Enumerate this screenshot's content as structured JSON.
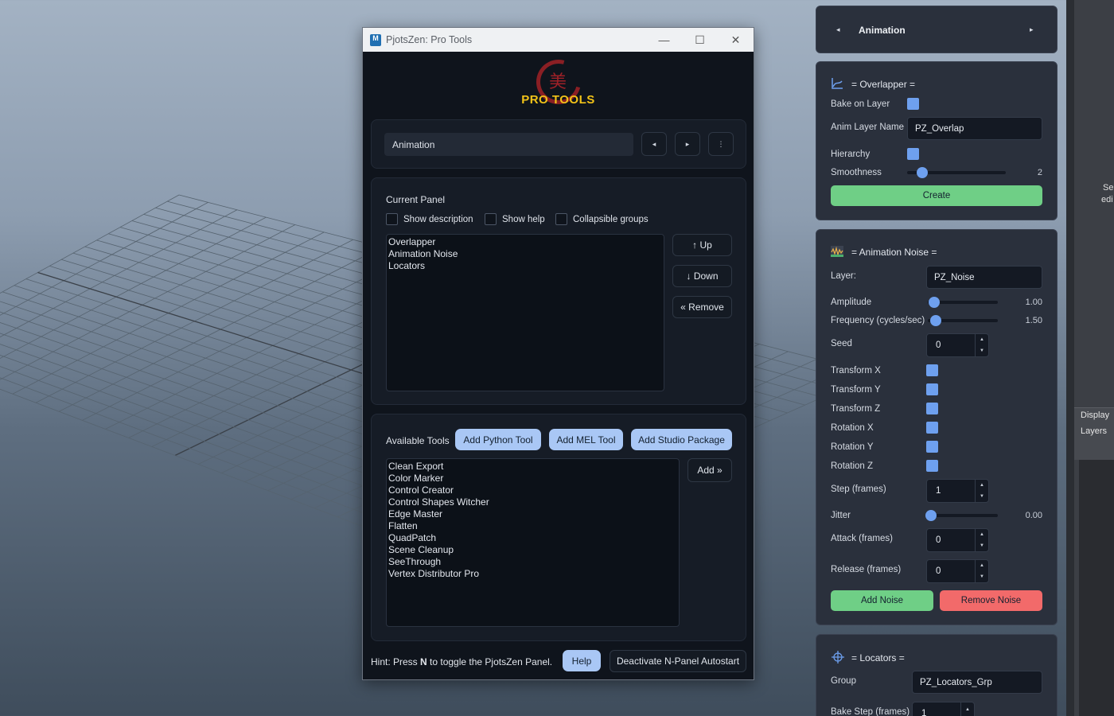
{
  "window": {
    "title": "PjotsZen: Pro Tools",
    "app_icon": "M",
    "minimize": "—",
    "maximize": "☐",
    "close": "✕",
    "brand_kanji": "美",
    "brand_text": "PRO TOOLS",
    "panel_selector": {
      "value": "Animation",
      "prev": "◂",
      "next": "▸",
      "menu": "⋮"
    },
    "current_panel": {
      "heading": "Current Panel",
      "show_description": "Show description",
      "show_help": "Show help",
      "collapsible_groups": "Collapsible groups",
      "items": [
        "Overlapper",
        "Animation Noise",
        "Locators"
      ],
      "up": "↑ Up",
      "down": "↓ Down",
      "remove": "« Remove"
    },
    "available_tools": {
      "heading": "Available Tools",
      "add_python": "Add Python Tool",
      "add_mel": "Add MEL Tool",
      "add_studio": "Add Studio Package",
      "items": [
        "Clean Export",
        "Color Marker",
        "Control Creator",
        "Control Shapes Witcher",
        "Edge Master",
        "Flatten",
        "QuadPatch",
        "Scene Cleanup",
        "SeeThrough",
        "Vertex Distributor Pro"
      ],
      "add": "Add »"
    },
    "footer": {
      "hint_pre": "Hint: Press ",
      "hint_key": "N",
      "hint_post": " to toggle the PjotsZen Panel.",
      "help": "Help",
      "deactivate": "Deactivate N-Panel Autostart"
    }
  },
  "npanel": {
    "header": {
      "title": "Animation",
      "prev": "◂",
      "next": "▸"
    },
    "overlapper": {
      "title": "= Overlapper =",
      "bake_on_layer": "Bake on Layer",
      "anim_layer_name_label": "Anim Layer Name",
      "anim_layer_name": "PZ_Overlap",
      "hierarchy": "Hierarchy",
      "smoothness_label": "Smoothness",
      "smoothness_value": "2",
      "smoothness_fraction": 0.15,
      "create": "Create"
    },
    "noise": {
      "title": "= Animation Noise =",
      "layer_label": "Layer:",
      "layer": "PZ_Noise",
      "amplitude_label": "Amplitude",
      "amplitude": "1.00",
      "frequency_label": "Frequency (cycles/sec)",
      "frequency": "1.50",
      "seed_label": "Seed",
      "seed": "0",
      "transform_x": "Transform X",
      "transform_y": "Transform Y",
      "transform_z": "Transform Z",
      "rotation_x": "Rotation X",
      "rotation_y": "Rotation Y",
      "rotation_z": "Rotation Z",
      "step_label": "Step (frames)",
      "step": "1",
      "jitter_label": "Jitter",
      "jitter": "0.00",
      "attack_label": "Attack (frames)",
      "attack": "0",
      "release_label": "Release (frames)",
      "release": "0",
      "add_noise": "Add Noise",
      "remove_noise": "Remove Noise"
    },
    "locators": {
      "title": "= Locators =",
      "group_label": "Group",
      "group": "PZ_Locators_Grp",
      "bake_step_label": "Bake Step (frames)",
      "bake_step": "1"
    }
  },
  "sidebar_fragment": {
    "sel": "Sel",
    "edi": "edi",
    "display": "Display",
    "layers": "Layers"
  },
  "colors": {
    "accent": "#6ea0ef",
    "create": "#6fcf86",
    "remove": "#f26a6a",
    "brand": "#f2c318"
  }
}
